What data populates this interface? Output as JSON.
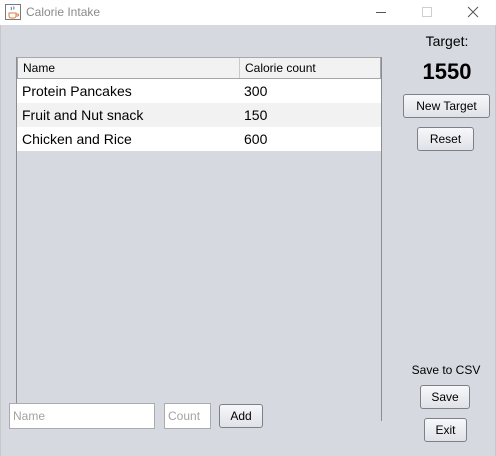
{
  "window": {
    "title": "Calorie Intake",
    "icon": "java-coffee-cup-icon"
  },
  "table": {
    "columns": [
      "Name",
      "Calorie count"
    ],
    "rows": [
      {
        "name": "Protein Pancakes",
        "count": "300"
      },
      {
        "name": "Fruit and Nut snack",
        "count": "150"
      },
      {
        "name": "Chicken and Rice",
        "count": "600"
      }
    ]
  },
  "target": {
    "label": "Target:",
    "value": "1550",
    "new_target_button": "New Target",
    "reset_button": "Reset"
  },
  "csv": {
    "label": "Save to CSV",
    "save_button": "Save",
    "exit_button": "Exit"
  },
  "add_form": {
    "name_placeholder": "Name",
    "name_value": "",
    "count_placeholder": "Count",
    "count_value": "",
    "add_button": "Add"
  },
  "colors": {
    "background": "#d6d9df",
    "row_alt": "#f2f2f2",
    "row": "#ffffff"
  }
}
